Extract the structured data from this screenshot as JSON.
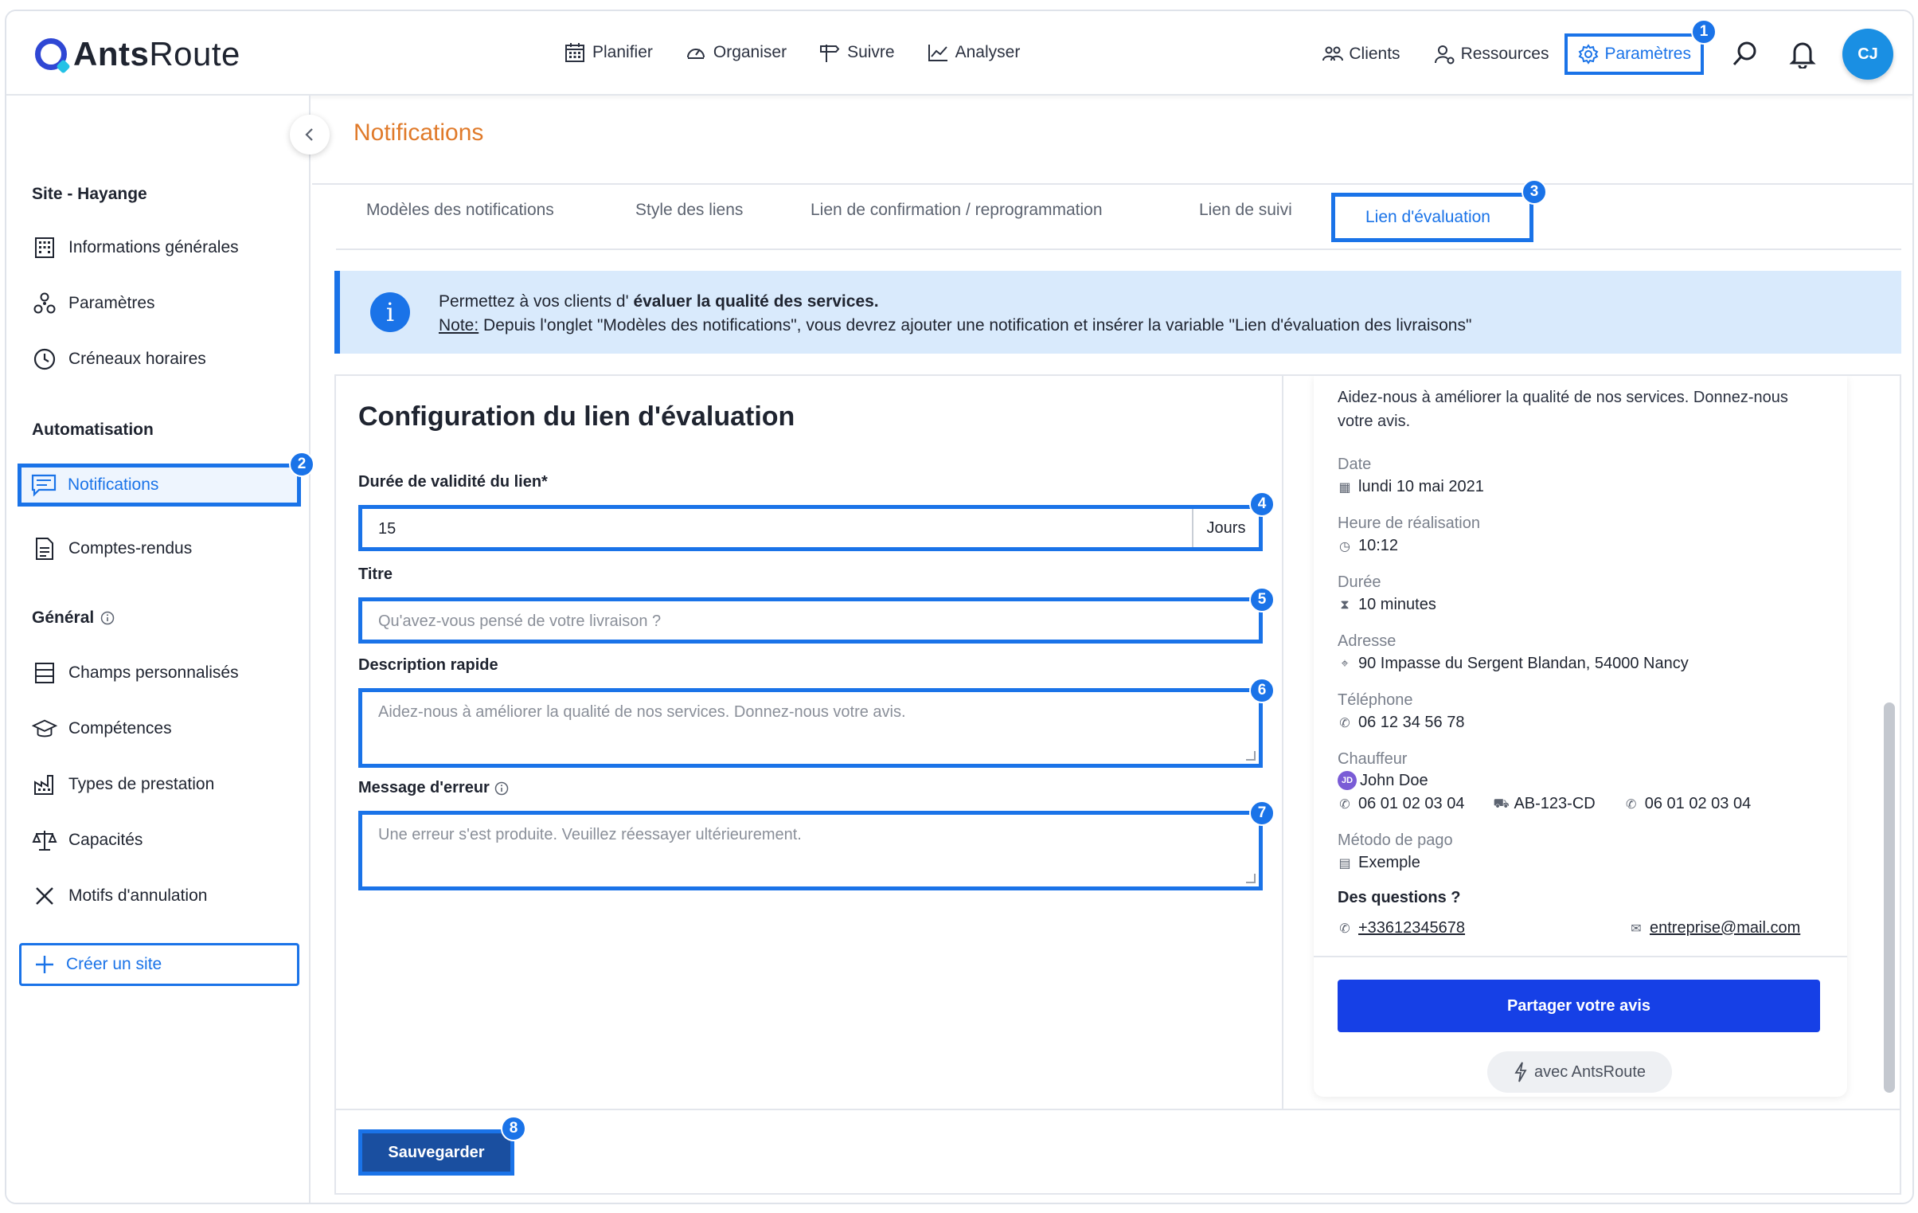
{
  "app": {
    "logo_bold": "Ants",
    "logo_regular": "Route",
    "user_initials": "CJ"
  },
  "topnav": {
    "main": [
      {
        "label": "Planifier",
        "icon": "calendar-icon"
      },
      {
        "label": "Organiser",
        "icon": "gauge-icon"
      },
      {
        "label": "Suivre",
        "icon": "signpost-icon"
      },
      {
        "label": "Analyser",
        "icon": "chart-icon"
      }
    ],
    "clients": "Clients",
    "ressources": "Ressources",
    "parametres": "Paramètres"
  },
  "badges": [
    "1",
    "2",
    "3",
    "4",
    "5",
    "6",
    "7",
    "8"
  ],
  "sidebar": {
    "site_title": "Site - Hayange",
    "site_items": [
      "Informations générales",
      "Paramètres",
      "Créneaux horaires"
    ],
    "automation_title": "Automatisation",
    "automation_items": [
      "Notifications",
      "Comptes-rendus"
    ],
    "general_title": "Général",
    "general_items": [
      "Champs personnalisés",
      "Compétences",
      "Types de prestation",
      "Capacités",
      "Motifs d'annulation"
    ],
    "create_site": "Créer un site"
  },
  "page": {
    "title": "Notifications",
    "tabs": [
      "Modèles des notifications",
      "Style des liens",
      "Lien de confirmation / reprogrammation",
      "Lien de suivi",
      "Lien d'évaluation"
    ],
    "info_line1_prefix": "Permettez à vos clients d'",
    "info_line1_bold": "évaluer la qualité des services.",
    "info_note_label": "Note:",
    "info_note_text": "Depuis l'onglet \"Modèles des notifications\", vous devrez ajouter une notification et insérer la variable \"Lien d'évaluation des livraisons\""
  },
  "form": {
    "heading": "Configuration du lien d'évaluation",
    "validity_label": "Durée de validité du lien*",
    "validity_value": "15",
    "validity_suffix": "Jours",
    "title_label": "Titre",
    "title_placeholder": "Qu'avez-vous pensé de votre livraison ?",
    "desc_label": "Description rapide",
    "desc_placeholder": "Aidez-nous à améliorer la qualité de nos services. Donnez-nous votre avis.",
    "error_label": "Message d'erreur",
    "error_placeholder": "Une erreur s'est produite. Veuillez réessayer ultérieurement.",
    "save": "Sauvegarder"
  },
  "preview": {
    "lead": "Aidez-nous à améliorer la qualité de nos services. Donnez-nous votre avis.",
    "date_label": "Date",
    "date_value": "lundi 10 mai 2021",
    "time_label": "Heure de réalisation",
    "time_value": "10:12",
    "duration_label": "Durée",
    "duration_value": "10 minutes",
    "address_label": "Adresse",
    "address_value": "90 Impasse du Sergent Blandan, 54000 Nancy",
    "phone_label": "Téléphone",
    "phone_value": "06 12 34 56 78",
    "driver_label": "Chauffeur",
    "driver_initials": "JD",
    "driver_name": "John Doe",
    "driver_phone": "06 01 02 03 04",
    "driver_plate": "AB-123-CD",
    "driver_phone2": "06 01 02 03 04",
    "payment_label": "Método de pago",
    "payment_value": "Exemple",
    "questions": "Des questions ?",
    "contact_phone": "+33612345678",
    "contact_email": "entreprise@mail.com",
    "share": "Partager votre avis",
    "powered": "avec AntsRoute"
  }
}
